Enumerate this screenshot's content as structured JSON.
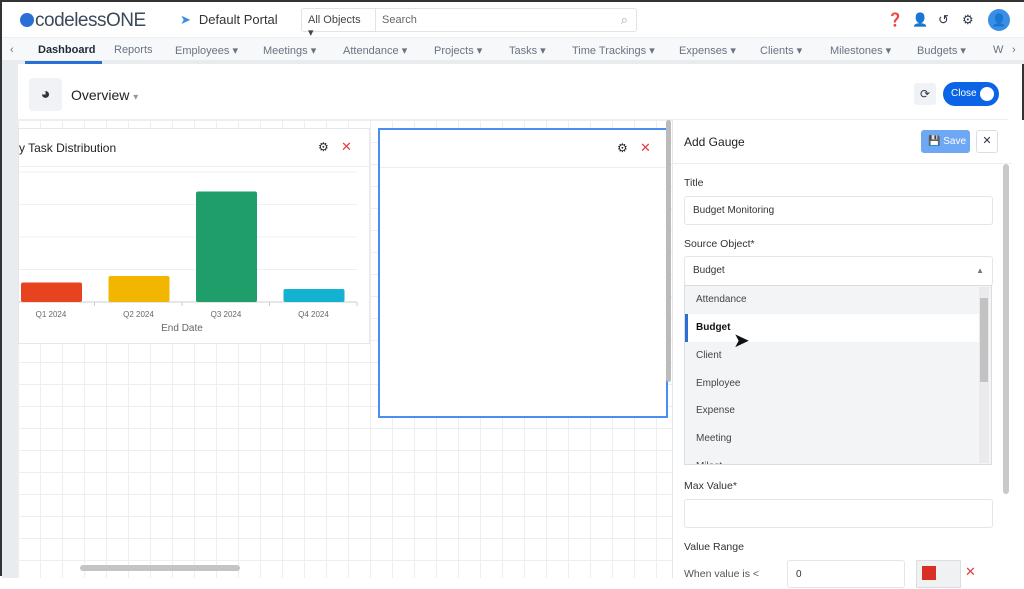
{
  "app": {
    "logo": "codelessONE",
    "portal": "Default Portal"
  },
  "search": {
    "scope": "All Objects",
    "placeholder": "Search"
  },
  "nav": {
    "items": [
      {
        "label": "Dashboard"
      },
      {
        "label": "Reports"
      },
      {
        "label": "Employees"
      },
      {
        "label": "Meetings"
      },
      {
        "label": "Attendance"
      },
      {
        "label": "Projects"
      },
      {
        "label": "Tasks"
      },
      {
        "label": "Time Trackings"
      },
      {
        "label": "Expenses"
      },
      {
        "label": "Clients"
      },
      {
        "label": "Milestones"
      },
      {
        "label": "Budgets"
      },
      {
        "label": "W"
      }
    ],
    "active": "Dashboard"
  },
  "overview": {
    "title": "Overview",
    "close_label": "Close"
  },
  "widget1": {
    "title": "y Task Distribution"
  },
  "chart_data": {
    "type": "bar",
    "categories": [
      "Q1 2024",
      "Q2 2024",
      "Q3 2024",
      "Q4 2024"
    ],
    "values": [
      0.6,
      0.8,
      3.4,
      0.4
    ],
    "xlabel": "End Date",
    "ylabel": "",
    "ylim": [
      0,
      4
    ],
    "grid": true,
    "colors": [
      "#e8431f",
      "#f2b500",
      "#1f9d6a",
      "#13b2d1"
    ]
  },
  "panel": {
    "title": "Add Gauge",
    "save_label": "Save",
    "title_label": "Title",
    "title_value": "Budget Monitoring",
    "source_label": "Source Object*",
    "source_value": "Budget",
    "options": [
      "Attendance",
      "Budget",
      "Client",
      "Employee",
      "Expense",
      "Meeting",
      "Milest..."
    ],
    "selected_option": "Budget",
    "max_label": "Max Value*",
    "max_value": "",
    "range_label": "Value Range",
    "range_row_label": "When value is <",
    "range_value": "0",
    "range_color": "#d93025"
  }
}
